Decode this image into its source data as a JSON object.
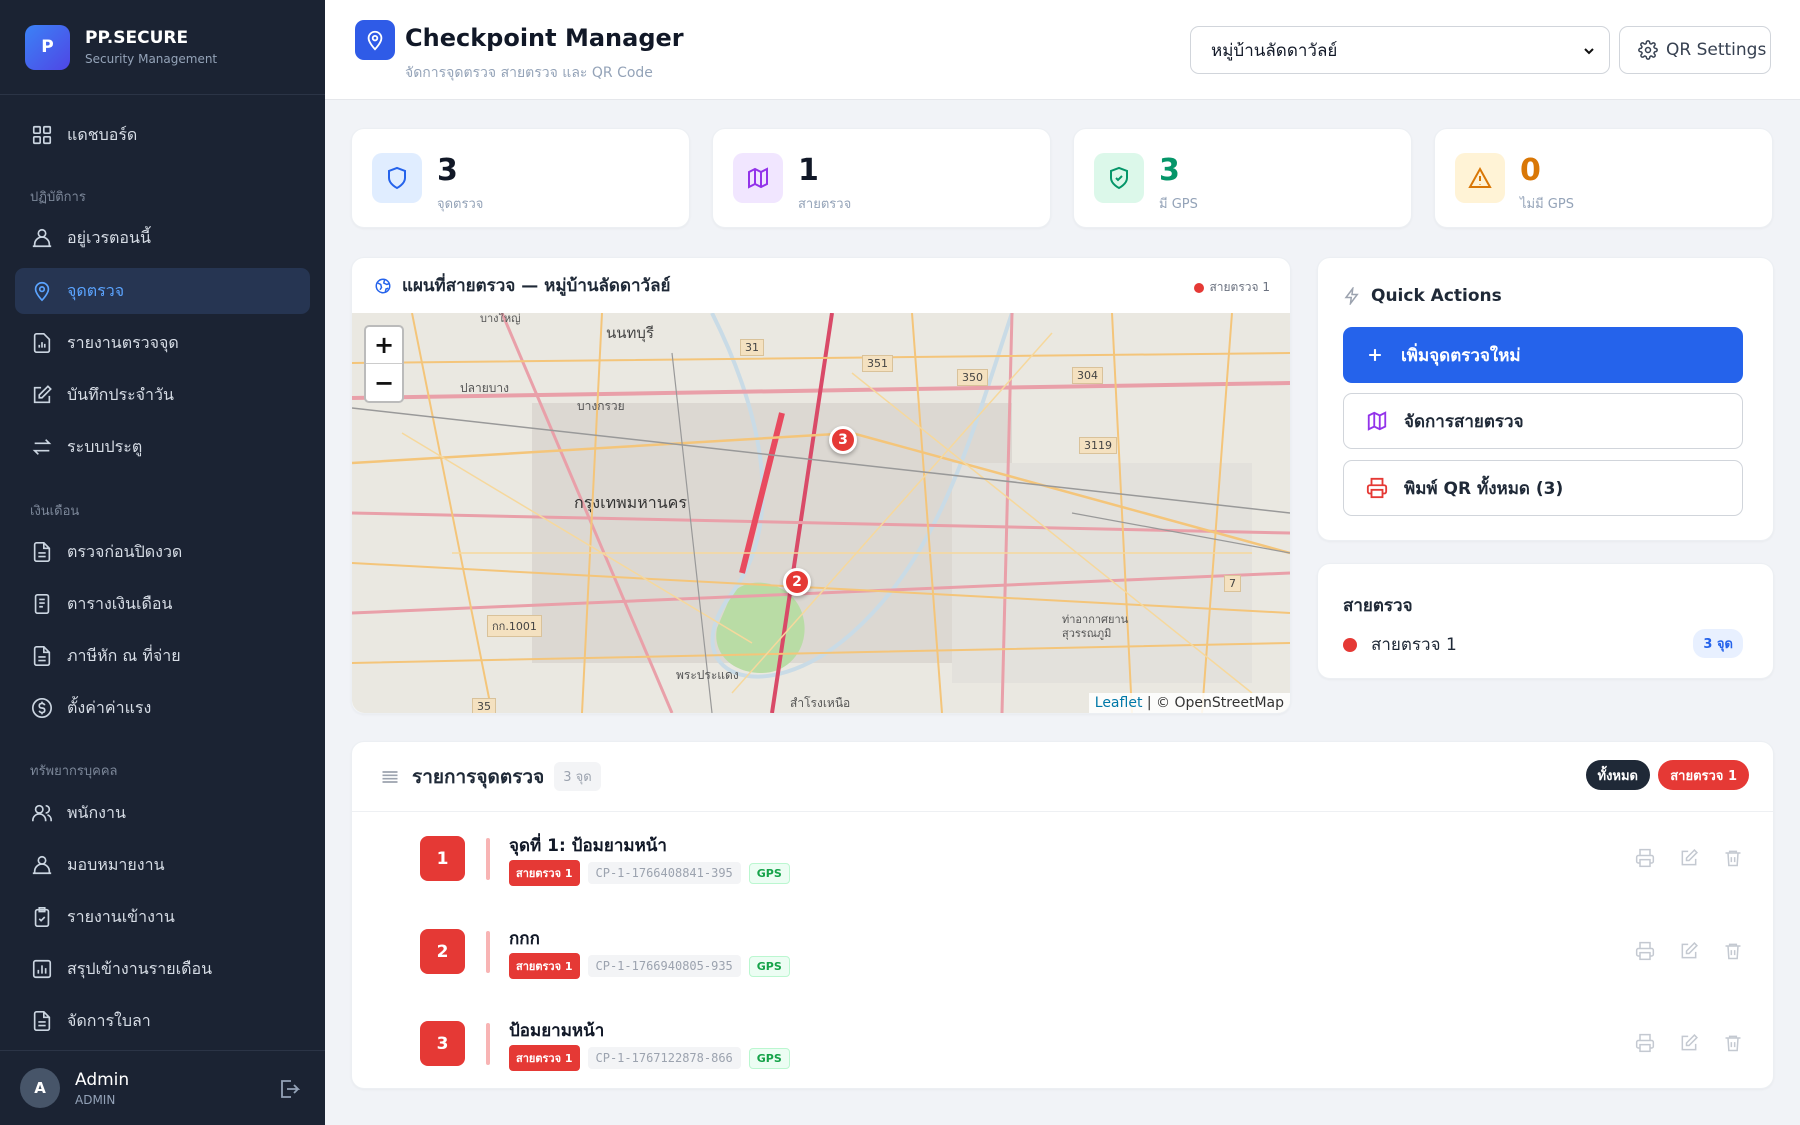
{
  "brand": {
    "logo_letter": "P",
    "name": "PP.SECURE",
    "subtitle": "Security Management"
  },
  "sidebar": {
    "dashboard": "แดชบอร์ด",
    "sections": [
      "ปฏิบัติการ",
      "เงินเดือน",
      "ทรัพยากรบุคคล"
    ],
    "operations": [
      "อยู่เวรตอนนี้",
      "จุดตรวจ",
      "รายงานตรวจจุด",
      "บันทึกประจำวัน",
      "ระบบประตู"
    ],
    "payroll": [
      "ตรวจก่อนปิดงวด",
      "ตารางเงินเดือน",
      "ภาษีหัก ณ ที่จ่าย",
      "ตั้งค่าค่าแรง"
    ],
    "hr": [
      "พนักงาน",
      "มอบหมายงาน",
      "รายงานเข้างาน",
      "สรุปเข้างานรายเดือน",
      "จัดการใบลา"
    ],
    "active": "จุดตรวจ"
  },
  "user": {
    "avatar_letter": "A",
    "name": "Admin",
    "role": "ADMIN"
  },
  "header": {
    "title": "Checkpoint Manager",
    "subtitle": "จัดการจุดตรวจ สายตรวจ และ QR Code",
    "village_selected": "หมู่บ้านลัดดาวัลย์",
    "qr_settings": "QR Settings"
  },
  "stats": [
    {
      "value": "3",
      "label": "จุดตรวจ",
      "color": "#1f2937"
    },
    {
      "value": "1",
      "label": "สายตรวจ",
      "color": "#1f2937"
    },
    {
      "value": "3",
      "label": "มี GPS",
      "color": "#059669"
    },
    {
      "value": "0",
      "label": "ไม่มี GPS",
      "color": "#d97706"
    }
  ],
  "map": {
    "title": "แผนที่สายตรวจ — หมู่บ้านลัดดาวัลย์",
    "legend": "สายตรวจ 1",
    "zoom_in": "+",
    "zoom_out": "−",
    "attribution_link": "Leaflet",
    "attribution_rest": "| © OpenStreetMap",
    "places": [
      "นนทบุรี",
      "กรุงเทพมหานคร",
      "ปลายบาง",
      "บางกรวย",
      "พระประแดง",
      "สำโรงเหนือ",
      "ท่าอากาศยานสุวรรณภูมิ",
      "บางใหญ่"
    ],
    "road_labels": [
      "31",
      "351",
      "350",
      "304",
      "3119",
      "7",
      "กก.1001",
      "35"
    ],
    "markers": [
      "3",
      "2"
    ]
  },
  "quick_actions": {
    "title": "Quick Actions",
    "add": "เพิ่มจุดตรวจใหม่",
    "manage_routes": "จัดการสายตรวจ",
    "print_all": "พิมพ์ QR ทั้งหมด (3)"
  },
  "routes": {
    "title": "สายตรวจ",
    "items": [
      {
        "name": "สายตรวจ 1",
        "count": "3 จุด",
        "color": "#e53935"
      }
    ]
  },
  "checkpoints": {
    "title": "รายการจุดตรวจ",
    "count": "3 จุด",
    "filter_all": "ทั้งหมด",
    "filter_route": "สายตรวจ 1",
    "rows": [
      {
        "num": "1",
        "name": "จุดที่ 1: ป้อมยามหน้า",
        "route": "สายตรวจ 1",
        "code": "CP-1-1766408841-395",
        "gps": "GPS"
      },
      {
        "num": "2",
        "name": "กกก",
        "route": "สายตรวจ 1",
        "code": "CP-1-1766940805-935",
        "gps": "GPS"
      },
      {
        "num": "3",
        "name": "ป้อมยามหน้า",
        "route": "สายตรวจ 1",
        "code": "CP-1-1767122878-866",
        "gps": "GPS"
      }
    ]
  }
}
